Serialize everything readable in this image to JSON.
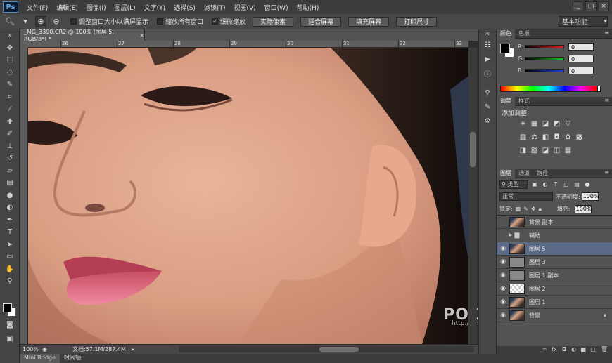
{
  "app": {
    "logo": "Ps"
  },
  "menu": [
    "文件(F)",
    "编辑(E)",
    "图像(I)",
    "图层(L)",
    "文字(Y)",
    "选择(S)",
    "滤镜(T)",
    "视图(V)",
    "窗口(W)",
    "帮助(H)"
  ],
  "window_controls": [
    "_",
    "□",
    "×"
  ],
  "options": {
    "checks": [
      {
        "label": "调整窗口大小以满屏显示",
        "checked": false
      },
      {
        "label": "缩放所有窗口",
        "checked": false
      },
      {
        "label": "细微缩放",
        "checked": true
      }
    ],
    "buttons": [
      "实际像素",
      "适合屏幕",
      "填充屏幕",
      "打印尺寸"
    ],
    "workspace": "基本功能"
  },
  "document": {
    "tab_title": "_MG_3390.CR2 @ 100% (图层 5, RGB/8*) *",
    "ruler_ticks": [
      "26",
      "27",
      "28",
      "29",
      "30",
      "31",
      "32",
      "33"
    ],
    "zoom": "100%",
    "doc_info": "文档:57.1M/287.4M"
  },
  "bottom_tabs": [
    "Mini Bridge",
    "时间轴"
  ],
  "color_panel": {
    "tabs": [
      "颜色",
      "色板"
    ],
    "channels": [
      {
        "label": "R",
        "value": "0",
        "color": "#e02020"
      },
      {
        "label": "G",
        "value": "0",
        "color": "#20c020"
      },
      {
        "label": "B",
        "value": "0",
        "color": "#2040e0"
      }
    ]
  },
  "adjustments_panel": {
    "tabs": [
      "调整",
      "样式"
    ],
    "title": "添加调整"
  },
  "layers_panel": {
    "tabs": [
      "图层",
      "通道",
      "路径"
    ],
    "kind": "类型",
    "blend_mode": "正常",
    "opacity_label": "不透明度:",
    "opacity": "100%",
    "lock_label": "锁定:",
    "fill_label": "填充:",
    "fill": "100%",
    "layers": [
      {
        "name": "背景 副本",
        "visible": false,
        "thumb": "face",
        "selected": false
      },
      {
        "name": "辅助",
        "visible": false,
        "thumb": "folder",
        "selected": false
      },
      {
        "name": "图层 5",
        "visible": true,
        "thumb": "face",
        "selected": true
      },
      {
        "name": "图层 3",
        "visible": true,
        "thumb": "grey",
        "selected": false
      },
      {
        "name": "图层 1 副本",
        "visible": true,
        "thumb": "grey",
        "selected": false
      },
      {
        "name": "图层 2",
        "visible": true,
        "thumb": "trans",
        "selected": false
      },
      {
        "name": "图层 1",
        "visible": true,
        "thumb": "face",
        "selected": false
      },
      {
        "name": "背景",
        "visible": true,
        "thumb": "face",
        "selected": false,
        "locked": true
      }
    ]
  },
  "watermark": {
    "brand": "POCO 摄影",
    "url": "http://photo.poco.cn/"
  }
}
